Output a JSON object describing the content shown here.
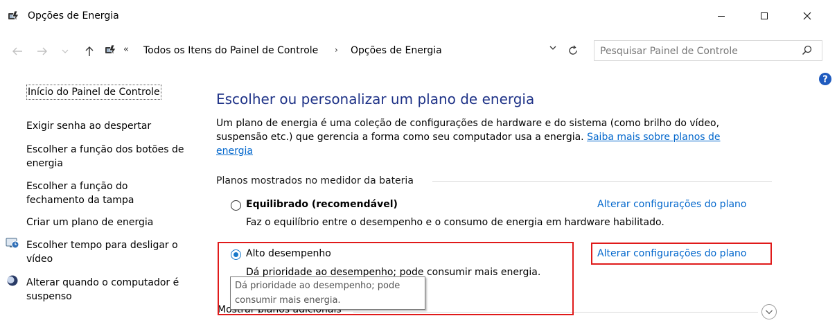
{
  "window": {
    "title": "Opções de Energia"
  },
  "address": {
    "chevron": "«",
    "crumbs": [
      "Todos os Itens do Painel de Controle",
      "Opções de Energia"
    ],
    "separator": "›"
  },
  "search": {
    "placeholder": "Pesquisar Painel de Controle"
  },
  "sidebar": {
    "home": "Início do Painel de Controle",
    "items": [
      {
        "label": "Exigir senha ao despertar"
      },
      {
        "label": "Escolher a função dos botões de energia"
      },
      {
        "label": "Escolher a função do fechamento da tampa"
      },
      {
        "label": "Criar um plano de energia"
      },
      {
        "label": "Escolher tempo para desligar o vídeo",
        "icon": "display-clock-icon"
      },
      {
        "label": "Alterar quando o computador é suspenso",
        "icon": "moon-icon"
      }
    ]
  },
  "main": {
    "heading": "Escolher ou personalizar um plano de energia",
    "description": "Um plano de energia é uma coleção de configurações de hardware e do sistema (como brilho do vídeo, suspensão etc.) que gerencia a forma como seu computador usa a energia.",
    "learn_more": "Saiba mais sobre planos de energia",
    "group_label": "Planos mostrados no medidor da bateria",
    "plans": [
      {
        "name": "Equilibrado (recomendável)",
        "link": "Alterar configurações do plano",
        "desc": "Faz o equilíbrio entre o desempenho e o consumo de energia em hardware habilitado.",
        "selected": false
      },
      {
        "name": "Alto desempenho",
        "link": "Alterar configurações do plano",
        "desc": "Dá prioridade ao desempenho; pode consumir mais energia.",
        "selected": true
      }
    ],
    "tooltip": "Dá prioridade ao desempenho; pode consumir mais energia.",
    "more_plans": "Mostrar planos adicionais"
  },
  "colors": {
    "link": "#0066cc",
    "heading": "#1e3287",
    "highlight": "#e01a1a",
    "radio_selected": "#1979ca"
  }
}
